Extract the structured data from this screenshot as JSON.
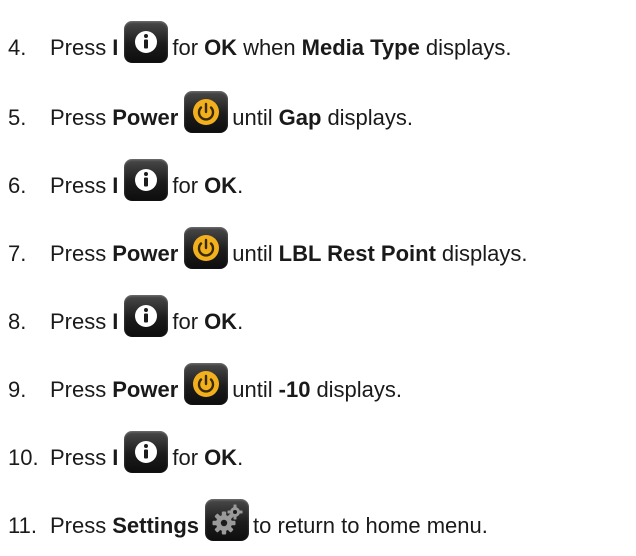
{
  "steps": [
    {
      "num": "4.",
      "press": "Press",
      "key": "I",
      "icon": "info-icon",
      "mid": "for",
      "bold1": "OK",
      "tail": "when",
      "bold2": "Media Type",
      "end": "displays."
    },
    {
      "num": "5.",
      "press": "Press",
      "key": "Power",
      "icon": "power-icon",
      "mid": "until",
      "bold1": "Gap",
      "end": "displays."
    },
    {
      "num": "6.",
      "press": "Press",
      "key": "I",
      "icon": "info-icon",
      "mid": "for",
      "bold1": "OK",
      "end": "."
    },
    {
      "num": "7.",
      "press": "Press",
      "key": "Power",
      "icon": "power-icon",
      "mid": "until",
      "bold1": "LBL Rest Point",
      "end": "displays."
    },
    {
      "num": "8.",
      "press": "Press",
      "key": "I",
      "icon": "info-icon",
      "mid": "for",
      "bold1": "OK",
      "end": "."
    },
    {
      "num": "9.",
      "press": "Press",
      "key": "Power",
      "icon": "power-icon",
      "mid": "until",
      "bold1": "-10",
      "end": "displays."
    },
    {
      "num": "10.",
      "press": "Press",
      "key": "I",
      "icon": "info-icon",
      "mid": "for",
      "bold1": "OK",
      "end": "."
    },
    {
      "num": "11.",
      "press": "Press",
      "key": "Settings",
      "icon": "settings-gear-icon",
      "mid": "to return to home menu."
    }
  ],
  "colors": {
    "text": "#1a1a1a",
    "icon_bg": "#1c1c1c",
    "info_glyph": "#ffffff",
    "power_ring": "#f2b01e",
    "power_glyph": "#3a2a00",
    "gear": "#9a9a9a"
  }
}
